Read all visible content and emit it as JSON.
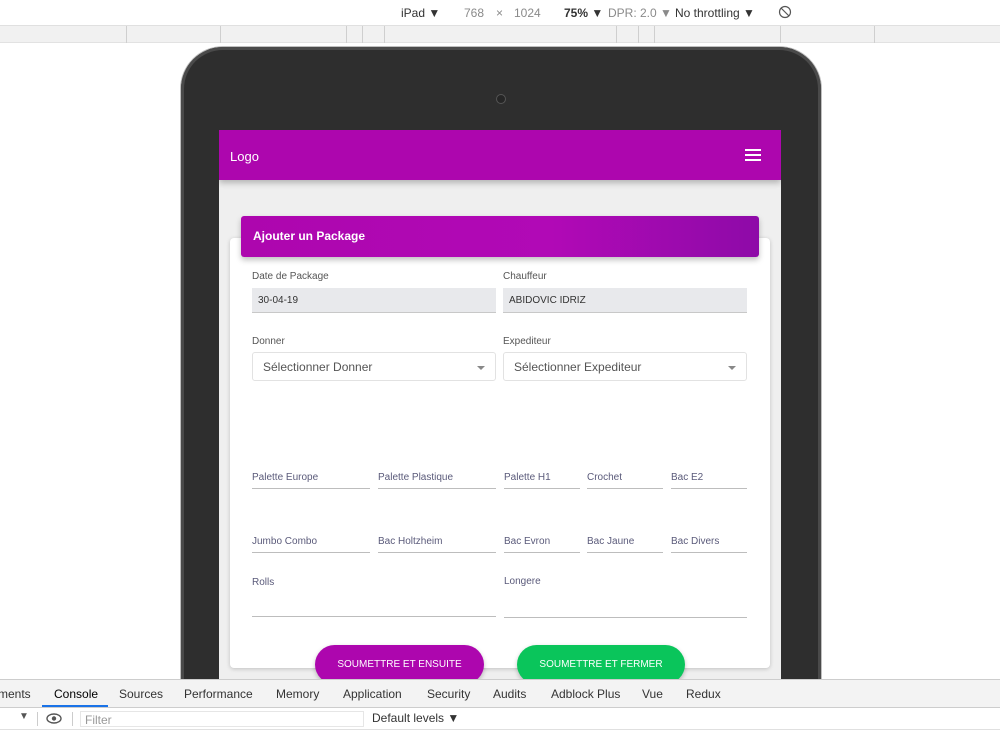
{
  "device_toolbar": {
    "device": "iPad",
    "device_caret": "▼",
    "width": "768",
    "times": "×",
    "height": "1024",
    "zoom": "75%",
    "zoom_caret": "▼",
    "dpr": "DPR: 2.0",
    "dpr_caret": "▼",
    "throttle": "No throttling",
    "throttle_caret": "▼"
  },
  "app": {
    "logo": "Logo",
    "form_title": "Ajouter un Package",
    "fields": {
      "date_label": "Date de Package",
      "date_value": "30-04-19",
      "driver_label": "Chauffeur",
      "driver_value": "ABIDOVIC IDRIZ",
      "donner_label": "Donner",
      "donner_placeholder": "Sélectionner Donner",
      "expediteur_label": "Expediteur",
      "expediteur_placeholder": "Sélectionner Expediteur"
    },
    "row1": [
      "Palette Europe",
      "Palette Plastique",
      "Palette H1",
      "Crochet",
      "Bac E2"
    ],
    "row2": [
      "Jumbo Combo",
      "Bac Holtzheim",
      "Bac Evron",
      "Bac Jaune",
      "Bac Divers"
    ],
    "rolls_label": "Rolls",
    "longere_label": "Longere",
    "submit_next": "SOUMETTRE ET ENSUITE",
    "submit_close": "SOUMETTRE ET FERMER",
    "colors": {
      "primary": "#ad06ae",
      "success": "#0ac55b"
    }
  },
  "devtools": {
    "tabs": [
      "ments",
      "Console",
      "Sources",
      "Performance",
      "Memory",
      "Application",
      "Security",
      "Audits",
      "Adblock Plus",
      "Vue",
      "Redux"
    ],
    "filter_placeholder": "Filter",
    "levels": "Default levels ▼",
    "context_caret": "▼"
  }
}
